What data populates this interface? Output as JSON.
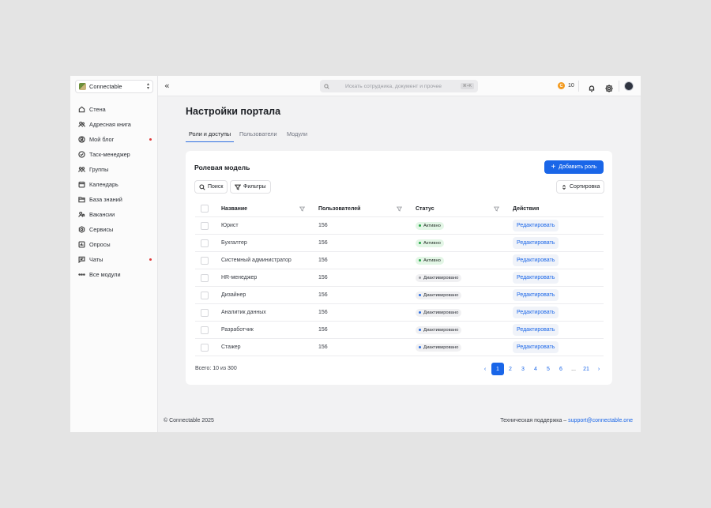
{
  "org": {
    "name": "Connectable"
  },
  "sidebar": {
    "items": [
      {
        "label": "Стена",
        "icon": "home-icon",
        "dot": false
      },
      {
        "label": "Адресная книга",
        "icon": "contacts-icon",
        "dot": false
      },
      {
        "label": "Мой блог",
        "icon": "user-circle-icon",
        "dot": true
      },
      {
        "label": "Таск-менеджер",
        "icon": "check-circle-icon",
        "dot": false
      },
      {
        "label": "Группы",
        "icon": "group-icon",
        "dot": false
      },
      {
        "label": "Календарь",
        "icon": "calendar-icon",
        "dot": false
      },
      {
        "label": "База знаний",
        "icon": "folder-icon",
        "dot": false
      },
      {
        "label": "Вакансии",
        "icon": "user-search-icon",
        "dot": false
      },
      {
        "label": "Сервисы",
        "icon": "hexagon-icon",
        "dot": false
      },
      {
        "label": "Опросы",
        "icon": "poll-icon",
        "dot": false
      },
      {
        "label": "Чаты",
        "icon": "chat-icon",
        "dot": true
      },
      {
        "label": "Все модули",
        "icon": "more-icon",
        "dot": false
      }
    ]
  },
  "topbar": {
    "search_placeholder": "Искать сотрудника, документ и прочее",
    "search_shortcut": "⌘+K",
    "coins": "10",
    "coin_symbol": "C"
  },
  "page": {
    "title": "Настройки портала",
    "tabs": [
      "Роли и доступы",
      "Пользователи",
      "Модули"
    ]
  },
  "card": {
    "title": "Ролевая модель",
    "add_button": "Добавить роль",
    "search_button": "Поиск",
    "filter_button": "Фильтры",
    "sort_button": "Сортировка"
  },
  "table": {
    "headers": [
      "Название",
      "Пользователей",
      "Статус",
      "Действия"
    ],
    "rows": [
      {
        "name": "Юрист",
        "users": "156",
        "status": "Активно",
        "status_type": "active",
        "action": "Редактировать"
      },
      {
        "name": "Бухгалтер",
        "users": "156",
        "status": "Активно",
        "status_type": "active",
        "action": "Редактировать"
      },
      {
        "name": "Системный администратор",
        "users": "156",
        "status": "Активно",
        "status_type": "active",
        "action": "Редактировать"
      },
      {
        "name": "HR-менеджер",
        "users": "156",
        "status": "Диактивировано",
        "status_type": "gray",
        "action": "Редактировать"
      },
      {
        "name": "Дизайнер",
        "users": "156",
        "status": "Диактивировано",
        "status_type": "blue",
        "action": "Редактировать"
      },
      {
        "name": "Аналитик данных",
        "users": "156",
        "status": "Диактивировано",
        "status_type": "blue",
        "action": "Редактировать"
      },
      {
        "name": "Разработчик",
        "users": "156",
        "status": "Диактивировано",
        "status_type": "blue",
        "action": "Редактировать"
      },
      {
        "name": "Стажер",
        "users": "156",
        "status": "Диактивировано",
        "status_type": "blue",
        "action": "Редактировать"
      }
    ]
  },
  "pagination": {
    "total": "Всего: 10 из 300",
    "pages": [
      "1",
      "2",
      "3",
      "4",
      "5",
      "6",
      "...",
      "21"
    ],
    "current": "1"
  },
  "footer": {
    "copyright": "© Connectable 2025",
    "support_label": "Техническая поддержка –",
    "support_email": "support@connectable.one"
  },
  "colors": {
    "accent": "#1a66e8",
    "active_badge": "#e3f6e6",
    "notification_dot": "#e03b3b",
    "coin": "#f39a1e"
  }
}
